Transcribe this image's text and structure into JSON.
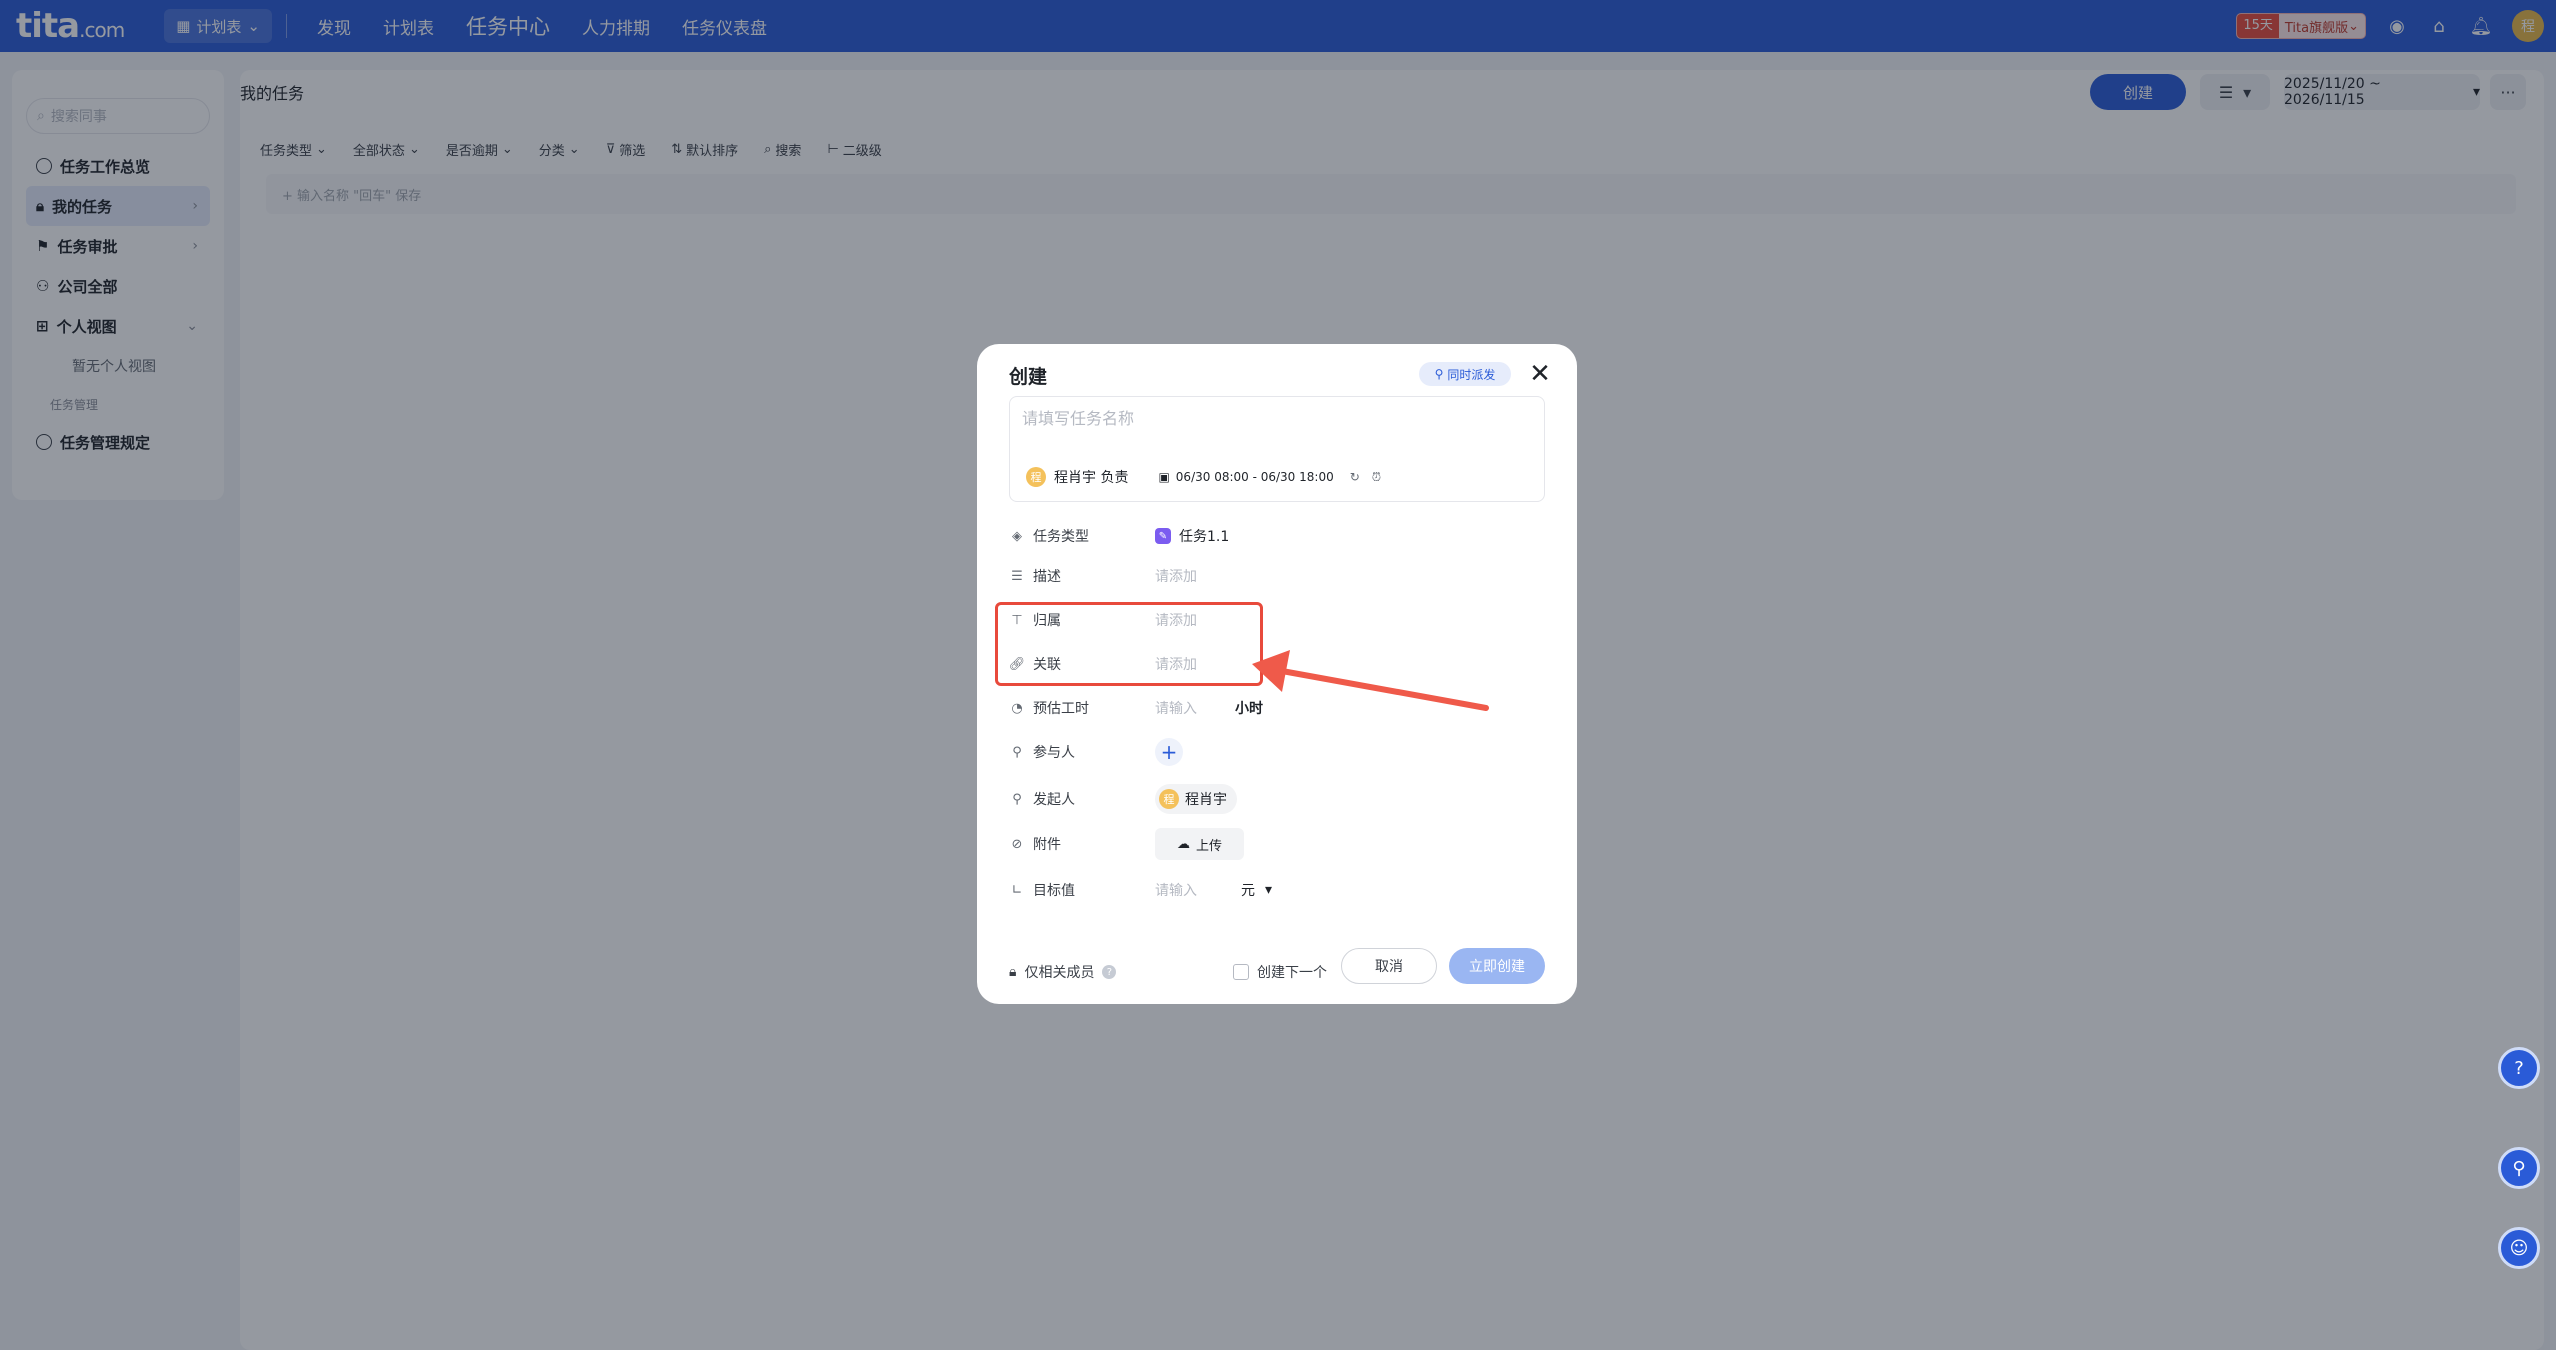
{
  "topbar": {
    "logo": "tita",
    "logo_suffix": ".com",
    "plan_switch": "计划表",
    "nav": [
      "发现",
      "计划表",
      "任务中心",
      "人力排期",
      "任务仪表盘"
    ],
    "trial_days": "15天",
    "trial_label": "Tita旗舰版",
    "avatar_text": "程"
  },
  "sidebar": {
    "search_placeholder": "搜索同事",
    "items": {
      "overview": "任务工作总览",
      "my_tasks": "我的任务",
      "approval": "任务审批",
      "company": "公司全部",
      "personal_view": "个人视图",
      "no_personal_view": "暂无个人视图",
      "group_manage": "任务管理",
      "rules": "任务管理规定"
    }
  },
  "main": {
    "title": "我的任务",
    "create_label": "创建",
    "date_range": "2025/11/20 ~ 2026/11/15",
    "filters": [
      "任务类型",
      "全部状态",
      "是否逾期",
      "分类",
      "筛选",
      "默认排序",
      "搜索",
      "二级级"
    ],
    "quick_add_placeholder": "+ 输入名称 \"回车\" 保存"
  },
  "modal": {
    "title": "创建",
    "dispatch_label": "同时派发",
    "task_name_placeholder": "请填写任务名称",
    "owner_avatar": "程",
    "owner_label": "程肖宇 负责",
    "date_text": "06/30 08:00 - 06/30 18:00",
    "fields": {
      "type_label": "任务类型",
      "type_value": "任务1.1",
      "desc_label": "描述",
      "desc_value": "请添加",
      "belong_label": "归属",
      "belong_value": "请添加",
      "relate_label": "关联",
      "relate_value": "请添加",
      "hours_label": "预估工时",
      "hours_value": "请输入",
      "hours_unit": "小时",
      "participants_label": "参与人",
      "initiator_label": "发起人",
      "initiator_avatar": "程",
      "initiator_name": "程肖宇",
      "attachment_label": "附件",
      "upload_label": "上传",
      "target_label": "目标值",
      "target_value": "请输入",
      "target_unit": "元"
    },
    "footer": {
      "visibility_label": "仅相关成员",
      "next_label": "创建下一个",
      "cancel_label": "取消",
      "submit_label": "立即创建"
    }
  },
  "colors": {
    "brand": "#2a5bd7",
    "highlight": "#e84a3c",
    "arrow": "#ef5a4a"
  }
}
